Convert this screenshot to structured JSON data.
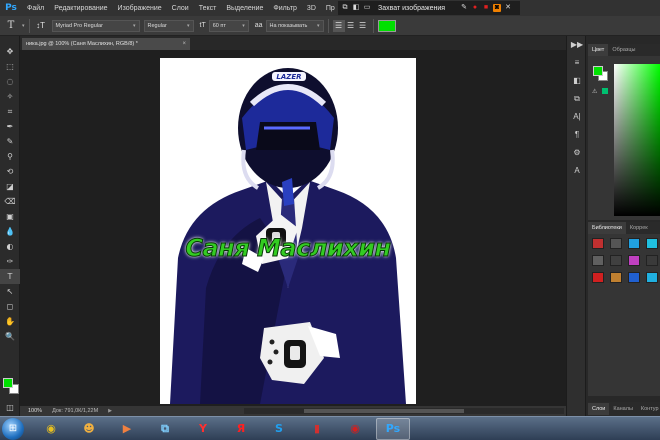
{
  "app": {
    "logo": "Ps"
  },
  "menu": [
    "Файл",
    "Редактирование",
    "Изображение",
    "Слои",
    "Текст",
    "Выделение",
    "Фильтр",
    "3D",
    "Пр"
  ],
  "capture_toolbar": {
    "title": "Захват изображения",
    "icons": [
      "pencil-icon",
      "record-icon",
      "stop-icon",
      "camera-icon",
      "close-icon"
    ]
  },
  "options_bar": {
    "tool_glyph": "T",
    "orientation_glyph": "↕T",
    "font_family": "Myriad Pro Regular",
    "font_style": "Regular",
    "font_size_glyph": "tT",
    "font_size": "60 пт",
    "antialias_glyph": "aa",
    "antialias": "На показывать",
    "text_color": "#00e000",
    "align": [
      "left",
      "center",
      "right"
    ]
  },
  "document": {
    "tab_label": "ника.jpg @ 100% (Саня Маслихин, RGB/8) *",
    "canvas_text": "Саня Маслихин",
    "canvas_text_color": "#33cc22"
  },
  "status": {
    "zoom": "100%",
    "doc_size": "Док: 791,0К/1,22М",
    "arrow": "▶"
  },
  "tools": [
    "✥",
    "⬚",
    "◌",
    "✧",
    "⌗",
    "✒",
    "✎",
    "⚲",
    "⟲",
    "◪",
    "⌫",
    "▣",
    "💧",
    "◐",
    "✑",
    "T",
    "↖",
    "◻",
    "✋",
    "🔍"
  ],
  "panels": {
    "color_tabs": [
      "Цвет",
      "Образцы"
    ],
    "color_warning": "⚠",
    "foreground_color": "#00e000",
    "background_color": "#ffffff",
    "swatch_tabs": [
      "Библиотеки",
      "Коррек"
    ],
    "swatches": [
      "#c03030",
      "#555555",
      "#20a0e0",
      "#20c0e0",
      "#606060",
      "#404040",
      "#c040c0",
      "#3a3a3a",
      "#d02020",
      "#c08030",
      "#2060d0",
      "#20b0e0"
    ],
    "layers_tabs": [
      "Слои",
      "Каналы",
      "Контур"
    ]
  },
  "strip_icons": [
    "▶▶",
    "≡",
    "◧",
    "⧉",
    "A|",
    "¶",
    "⚙",
    "A"
  ],
  "taskbar": {
    "start_glyph": "⊞",
    "apps": [
      {
        "name": "chrome-icon",
        "glyph": "◉",
        "color": "#e8c020"
      },
      {
        "name": "user-folder-icon",
        "glyph": "☻",
        "color": "#f0b040"
      },
      {
        "name": "media-player-icon",
        "glyph": "▶",
        "color": "#f08040"
      },
      {
        "name": "network-icon",
        "glyph": "⧉",
        "color": "#80d0ff"
      },
      {
        "name": "yandex-icon",
        "glyph": "Y",
        "color": "#ff3030"
      },
      {
        "name": "yandex-browser-icon",
        "glyph": "Я",
        "color": "#ff2020"
      },
      {
        "name": "skype-icon",
        "glyph": "S",
        "color": "#20a0f0"
      },
      {
        "name": "video-icon",
        "glyph": "▮",
        "color": "#d03030"
      },
      {
        "name": "chrome-red-icon",
        "glyph": "◉",
        "color": "#d02020"
      },
      {
        "name": "photoshop-icon",
        "glyph": "Ps",
        "color": "#31a8ff"
      }
    ]
  }
}
